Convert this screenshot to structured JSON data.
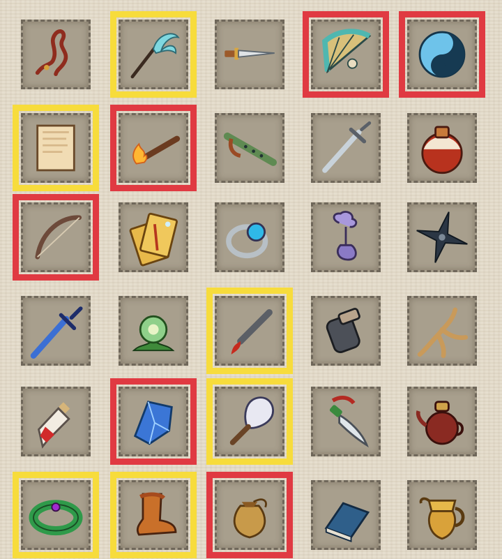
{
  "colors": {
    "red_highlight": "#e03a42",
    "yellow_highlight": "#f7dc3c",
    "slot_bg": "#a89f8d",
    "page_bg": "#e4dccb"
  },
  "inventory": {
    "rows": [
      [
        {
          "icon": "rope-whip-icon",
          "highlight": "none"
        },
        {
          "icon": "whisk-icon",
          "highlight": "yellow"
        },
        {
          "icon": "dagger-icon",
          "highlight": "none"
        },
        {
          "icon": "folding-fan-icon",
          "highlight": "red"
        },
        {
          "icon": "yin-yang-icon",
          "highlight": "red"
        }
      ],
      [
        {
          "icon": "scroll-icon",
          "highlight": "yellow"
        },
        {
          "icon": "torch-icon",
          "highlight": "red"
        },
        {
          "icon": "flute-icon",
          "highlight": "none"
        },
        {
          "icon": "sword-icon",
          "highlight": "none"
        },
        {
          "icon": "red-potion-gourd-icon",
          "highlight": "none"
        }
      ],
      [
        {
          "icon": "bow-icon",
          "highlight": "red"
        },
        {
          "icon": "talisman-icon",
          "highlight": "none"
        },
        {
          "icon": "ring-icon",
          "highlight": "none"
        },
        {
          "icon": "jade-pendant-icon",
          "highlight": "none"
        },
        {
          "icon": "shuriken-icon",
          "highlight": "none"
        }
      ],
      [
        {
          "icon": "blue-sword-icon",
          "highlight": "none"
        },
        {
          "icon": "lotus-flower-icon",
          "highlight": "none"
        },
        {
          "icon": "short-blade-icon",
          "highlight": "yellow"
        },
        {
          "icon": "gauntlet-icon",
          "highlight": "none"
        },
        {
          "icon": "ginseng-root-icon",
          "highlight": "none"
        }
      ],
      [
        {
          "icon": "potion-vial-icon",
          "highlight": "none"
        },
        {
          "icon": "blue-crystal-icon",
          "highlight": "red"
        },
        {
          "icon": "feather-fan-icon",
          "highlight": "yellow"
        },
        {
          "icon": "curved-knife-icon",
          "highlight": "none"
        },
        {
          "icon": "teapot-icon",
          "highlight": "none"
        }
      ],
      [
        {
          "icon": "jade-bracelet-icon",
          "highlight": "yellow"
        },
        {
          "icon": "boot-icon",
          "highlight": "yellow"
        },
        {
          "icon": "pouch-icon",
          "highlight": "red"
        },
        {
          "icon": "book-icon",
          "highlight": "none"
        },
        {
          "icon": "golden-pitcher-icon",
          "highlight": "none"
        }
      ]
    ]
  }
}
